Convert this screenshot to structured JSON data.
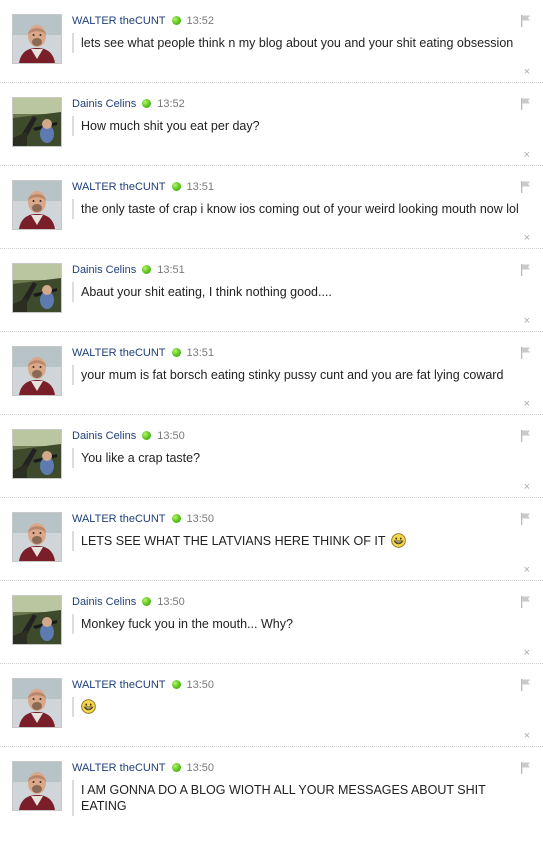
{
  "messages": [
    {
      "author": "WALTER theCUNT",
      "time": "13:52",
      "text": "lets see what people think n my blog about you and your shit eating obsession",
      "avatar": "walter",
      "emoji": false
    },
    {
      "author": "Dainis Celins",
      "time": "13:52",
      "text": "How much shit you eat per day?",
      "avatar": "dainis",
      "emoji": false
    },
    {
      "author": "WALTER theCUNT",
      "time": "13:51",
      "text": "the only taste of crap i know ios coming out of your weird looking mouth now lol",
      "avatar": "walter",
      "emoji": false
    },
    {
      "author": "Dainis Celins",
      "time": "13:51",
      "text": "Abaut your shit eating, I think nothing good....",
      "avatar": "dainis",
      "emoji": false
    },
    {
      "author": "WALTER theCUNT",
      "time": "13:51",
      "text": "your mum is fat borsch eating stinky pussy cunt and you are fat lying coward",
      "avatar": "walter",
      "emoji": false
    },
    {
      "author": "Dainis Celins",
      "time": "13:50",
      "text": "You like a crap taste?",
      "avatar": "dainis",
      "emoji": false
    },
    {
      "author": "WALTER theCUNT",
      "time": "13:50",
      "text": "LETS SEE WHAT THE LATVIANS HERE THINK OF IT",
      "avatar": "walter",
      "emoji": true
    },
    {
      "author": "Dainis Celins",
      "time": "13:50",
      "text": "Monkey fuck you in the mouth... Why?",
      "avatar": "dainis",
      "emoji": false
    },
    {
      "author": "WALTER theCUNT",
      "time": "13:50",
      "text": "",
      "avatar": "walter",
      "emoji": true
    },
    {
      "author": "WALTER theCUNT",
      "time": "13:50",
      "text": "I AM GONNA DO A BLOG WIOTH ALL YOUR MESSAGES ABOUT SHIT EATING",
      "avatar": "walter",
      "emoji": false
    }
  ],
  "controls": {
    "close_symbol": "×"
  },
  "colors": {
    "author": "#1f3f79",
    "online": "#58c21c",
    "timestamp": "#7a7a7a"
  },
  "icons": {
    "report": "flag-icon",
    "delete": "close-icon",
    "status": "online-status-icon",
    "smiley": "grin-emoji-icon"
  }
}
